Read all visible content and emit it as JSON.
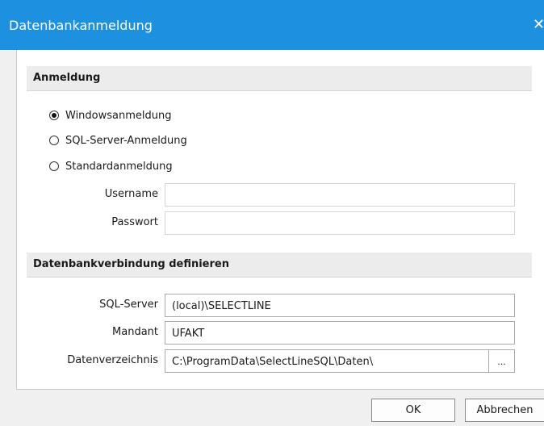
{
  "window": {
    "title": "Datenbankanmeldung",
    "close_glyph": "✕"
  },
  "login_group": {
    "header": "Anmeldung",
    "options": [
      {
        "label": "Windowsanmeldung",
        "checked": true
      },
      {
        "label": "SQL-Server-Anmeldung",
        "checked": false
      },
      {
        "label": "Standardanmeldung",
        "checked": false
      }
    ],
    "username_label": "Username",
    "username_value": "",
    "password_label": "Passwort",
    "password_value": ""
  },
  "connection_group": {
    "header": "Datenbankverbindung definieren",
    "server_label": "SQL-Server",
    "server_value": "(local)\\SELECTLINE",
    "client_label": "Mandant",
    "client_value": "UFAKT",
    "dir_label": "Datenverzeichnis",
    "dir_value": "C:\\ProgramData\\SelectLineSQL\\Daten\\",
    "browse_label": "..."
  },
  "buttons": {
    "ok": "OK",
    "cancel": "Abbrechen"
  }
}
